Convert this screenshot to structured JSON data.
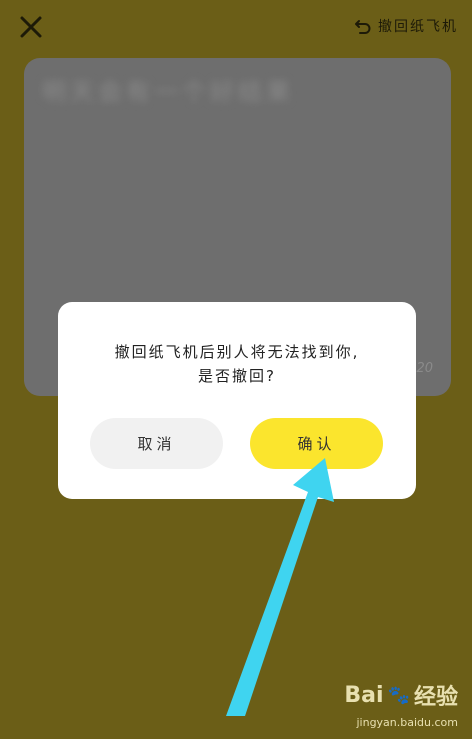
{
  "topbar": {
    "withdraw_label": "撤回纸飞机"
  },
  "card": {
    "blurred_text": "明天会有一个好结果",
    "date": "20"
  },
  "dialog": {
    "message_line1": "撤回纸飞机后别人将无法找到你,",
    "message_line2": "是否撤回?",
    "cancel_label": "取消",
    "confirm_label": "确认"
  },
  "annotation": {
    "arrow_color": "#3fd4f0"
  },
  "watermark": {
    "brand": "Bai",
    "brand_suffix": "经验",
    "url": "jingyan.baidu.com"
  },
  "colors": {
    "overlay": "#6b5e17",
    "confirm_button": "#fbe52d",
    "cancel_button": "#f1f1f1"
  }
}
